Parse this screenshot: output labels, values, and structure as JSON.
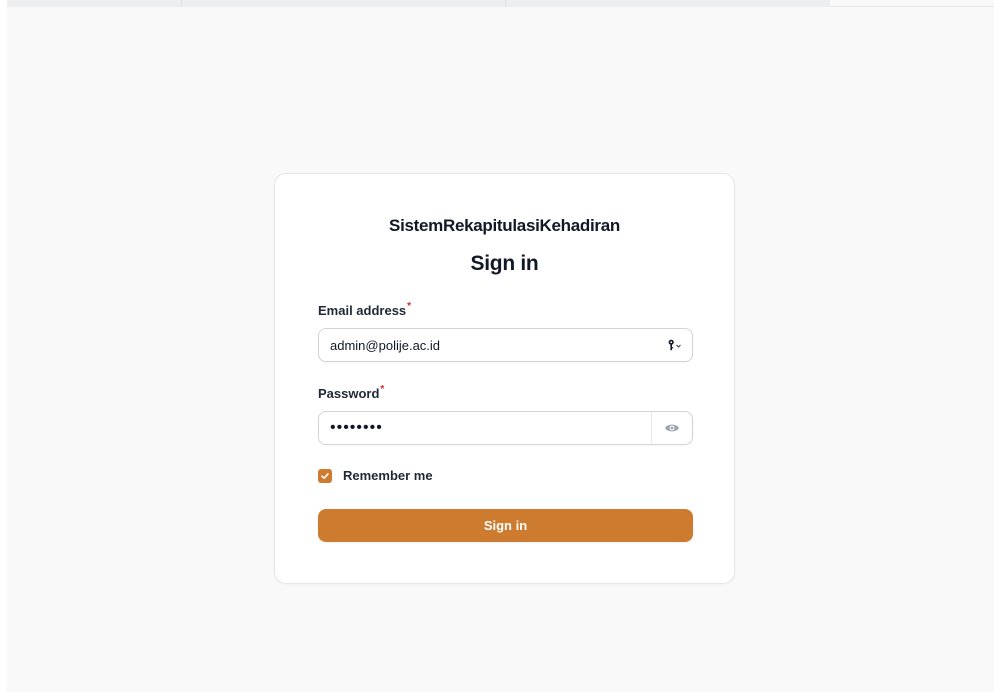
{
  "app": {
    "brand": "SistemRekapitulasiKehadiran"
  },
  "form": {
    "heading": "Sign in",
    "email": {
      "label": "Email address",
      "required_mark": "*",
      "value": "admin@polije.ac.id",
      "icon": "password-manager-key-icon"
    },
    "password": {
      "label": "Password",
      "required_mark": "*",
      "value": "••••••••",
      "toggle_icon": "eye-icon"
    },
    "remember": {
      "label": "Remember me",
      "checked": true
    },
    "submit_label": "Sign in"
  },
  "colors": {
    "accent": "#cd7b2f",
    "required": "#dc2626",
    "card_border": "#e5e7eb",
    "page_bg": "#f9f9f9"
  }
}
